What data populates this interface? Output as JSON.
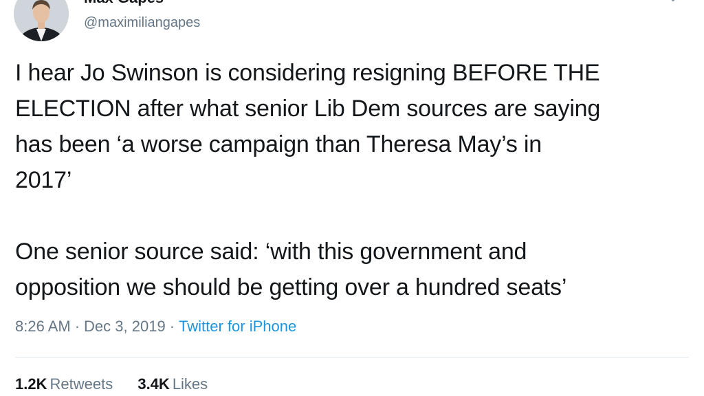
{
  "author": {
    "display_name": "Max Gapes",
    "handle": "@maximiliangapes"
  },
  "tweet": {
    "paragraphs": [
      "I hear Jo Swinson is considering resigning BEFORE THE\nELECTION after what senior Lib Dem sources are saying\nhas been ‘a worse campaign than Theresa May’s in\n2017’",
      "One senior source said: ‘with this government and\nopposition we should be getting over a hundred seats’"
    ]
  },
  "meta": {
    "time": "8:26 AM",
    "separator": "·",
    "date": "Dec 3, 2019",
    "source": "Twitter for iPhone"
  },
  "stats": {
    "retweets_count": "1.2K",
    "retweets_label": "Retweets",
    "likes_count": "3.4K",
    "likes_label": "Likes"
  },
  "icons": {
    "menu": "chevron-down-icon",
    "avatar": "profile-photo"
  },
  "colors": {
    "text": "#14171a",
    "secondary": "#657786",
    "link": "#1b95e0"
  }
}
